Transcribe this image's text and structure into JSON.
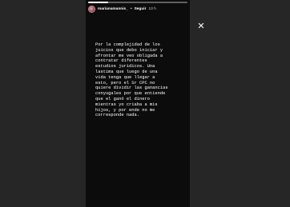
{
  "story": {
    "username": "marianamannis_",
    "separator": "•",
    "follow_label": "Seguir",
    "time": "13 h",
    "progress": 0.2,
    "text": "Por la complejidad de los\njuicios que debo iniciar y\nafrontar me veo obligada a\ncontratar diferentes\nestudios juridicos. Una\nlastima que luego de una\nvida tenga que llegar a\nesto, pero el Sr CPC no\nquiere dividir las ganancias\nconyugales por que entiende\nque el ganó el dinero\nmientras yo criaba a mis\nhijos, y por ende no me\ncorresponde nada."
  },
  "close": {
    "label": "✕"
  }
}
